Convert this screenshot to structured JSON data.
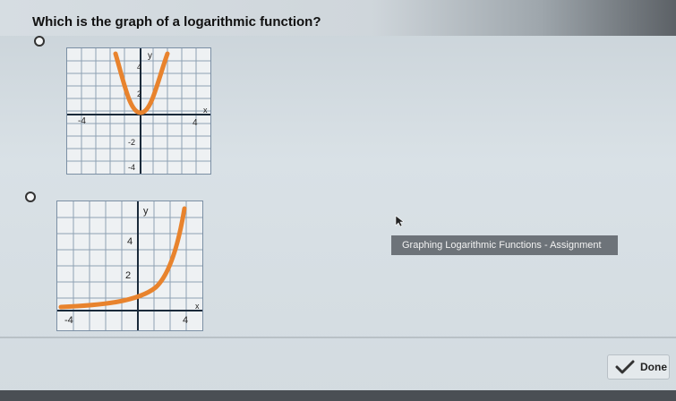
{
  "question": {
    "text": "Which is the graph of a logarithmic function?"
  },
  "options": [
    {
      "id": "option-a",
      "graph": {
        "type": "parabola",
        "axis_labels": {
          "y": "y",
          "x": "x"
        },
        "ticks": {
          "x_neg": "-4",
          "x_pos": "4",
          "y_top": "4",
          "y_mid": "2",
          "y_neg1": "-2",
          "y_neg2": "-4"
        }
      }
    },
    {
      "id": "option-b",
      "graph": {
        "type": "exponential",
        "axis_labels": {
          "y": "y",
          "x": "x"
        },
        "ticks": {
          "x_neg": "-4",
          "x_pos": "4",
          "y_top": "4",
          "y_mid": "2"
        }
      }
    }
  ],
  "banner": {
    "text": "Graphing Logarithmic Functions - Assignment"
  },
  "done_button": {
    "label": "Done",
    "icon": "checkmark-icon"
  },
  "colors": {
    "curve": "#e8832d",
    "grid_border": "#7b8fa4",
    "axis": "#1a2a3a"
  }
}
